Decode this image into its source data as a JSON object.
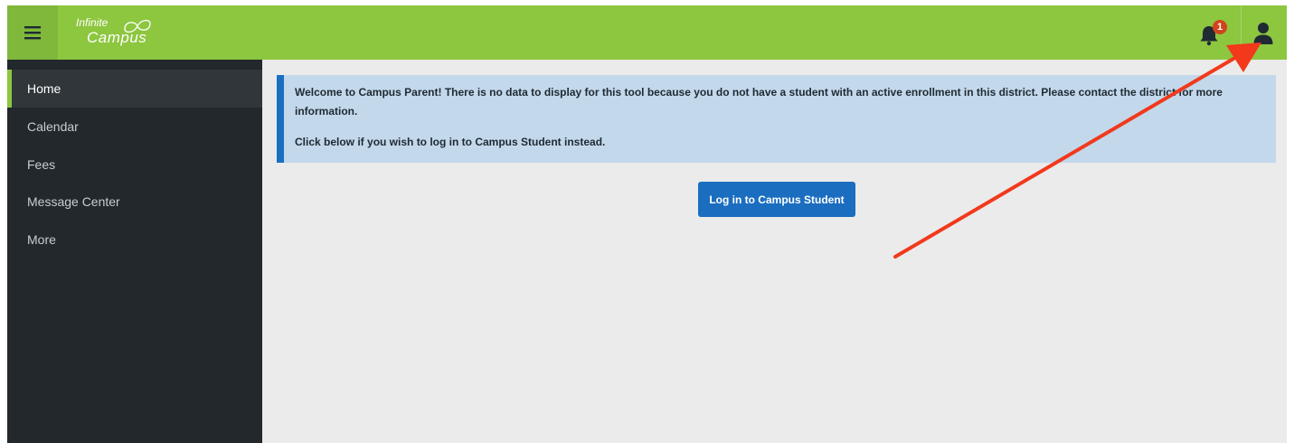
{
  "header": {
    "menu_icon": "hamburger-icon",
    "logo_line1": "Infinite",
    "logo_line2": "Campus",
    "notification_icon": "bell-icon",
    "notification_count": "1",
    "user_icon": "user-icon",
    "colors": {
      "bar": "#8dc63f",
      "badge": "#d2431d"
    }
  },
  "sidebar": {
    "items": [
      {
        "label": "Home",
        "active": true
      },
      {
        "label": "Calendar",
        "active": false
      },
      {
        "label": "Fees",
        "active": false
      },
      {
        "label": "Message Center",
        "active": false
      },
      {
        "label": "More",
        "active": false
      }
    ]
  },
  "main": {
    "notice_line1": "Welcome to Campus Parent! There is no data to display for this tool because you do not have a student with an active enrollment in this district. Please contact the district for more information.",
    "notice_line2": "Click below if you wish to log in to Campus Student instead.",
    "login_button": "Log in to Campus Student"
  },
  "annotation": {
    "type": "red-arrow",
    "points_to": "user-icon",
    "color": "#f2391c"
  }
}
